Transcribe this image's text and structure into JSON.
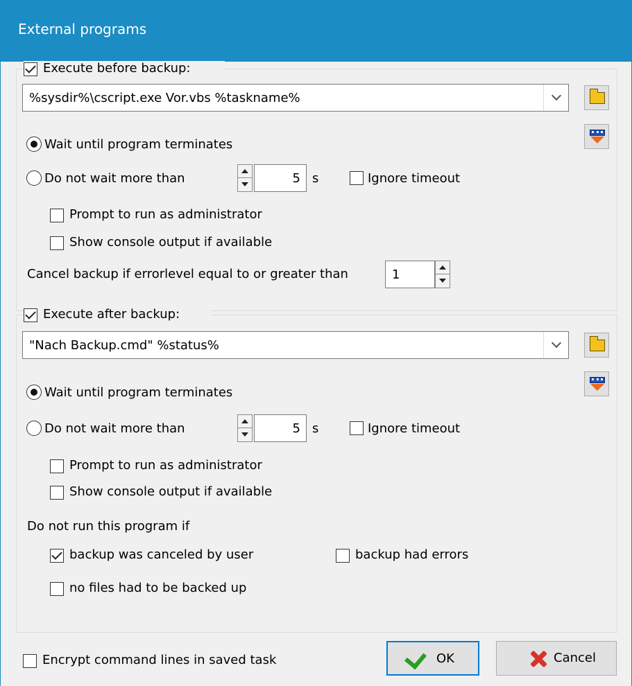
{
  "window": {
    "title": "External programs"
  },
  "before": {
    "group_label": "Execute before backup:",
    "enabled": true,
    "command": "%sysdir%\\cscript.exe Vor.vbs %taskname%",
    "wait_label": "Wait until program terminates",
    "wait_selected": true,
    "limit_label": "Do not wait more than",
    "timeout_value": "5",
    "unit": "s",
    "ignore_timeout_label": "Ignore timeout",
    "ignore_timeout": false,
    "admin_label": "Prompt to run as administrator",
    "admin": false,
    "console_label": "Show console output if available",
    "console": false,
    "errorlevel_label": "Cancel backup if errorlevel equal to or greater than",
    "errorlevel_value": "1"
  },
  "after": {
    "group_label": "Execute after backup:",
    "enabled": true,
    "command": "\"Nach Backup.cmd\" %status%",
    "wait_label": "Wait until program terminates",
    "wait_selected": true,
    "limit_label": "Do not wait more than",
    "timeout_value": "5",
    "unit": "s",
    "ignore_timeout_label": "Ignore timeout",
    "ignore_timeout": false,
    "admin_label": "Prompt to run as administrator",
    "admin": false,
    "console_label": "Show console output if available",
    "console": false,
    "skip_heading": "Do not run this program if",
    "canceled_label": "backup was canceled by user",
    "canceled": true,
    "errors_label": "backup had errors",
    "errors": false,
    "nofiles_label": "no files had to be backed up",
    "nofiles": false
  },
  "footer": {
    "encrypt_label": "Encrypt command lines in saved task",
    "encrypt": false,
    "ok_label": "OK",
    "cancel_label": "Cancel"
  },
  "icons": {
    "browse": "folder-icon",
    "variables": "insert-variable-icon",
    "ok": "checkmark-icon",
    "cancel": "red-x-icon"
  },
  "colors": {
    "titlebar": "#1b8cc4",
    "default_button_border": "#0078d7",
    "ok_check": "#2b9d1f",
    "cancel_x": "#d8322a"
  }
}
